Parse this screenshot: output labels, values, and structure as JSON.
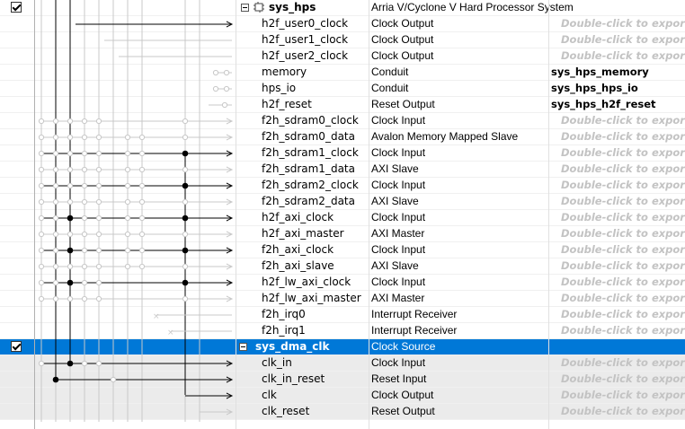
{
  "rows": [
    {
      "checkbox": true,
      "expander": true,
      "icon": "hps-chip-icon",
      "indent": 1,
      "name": "sys_hps",
      "bold": true,
      "description": "Arria V/Cyclone V Hard Processor System",
      "export": "",
      "export_type": "none",
      "style": "normal"
    },
    {
      "checkbox": false,
      "expander": false,
      "icon": "",
      "indent": 2,
      "name": "h2f_user0_clock",
      "bold": false,
      "description": "Clock Output",
      "export": "Double-click to export",
      "export_type": "placeholder",
      "style": "normal"
    },
    {
      "checkbox": false,
      "expander": false,
      "icon": "",
      "indent": 2,
      "name": "h2f_user1_clock",
      "bold": false,
      "description": "Clock Output",
      "export": "Double-click to export",
      "export_type": "placeholder",
      "style": "normal"
    },
    {
      "checkbox": false,
      "expander": false,
      "icon": "",
      "indent": 2,
      "name": "h2f_user2_clock",
      "bold": false,
      "description": "Clock Output",
      "export": "Double-click to export",
      "export_type": "placeholder",
      "style": "normal"
    },
    {
      "checkbox": false,
      "expander": false,
      "icon": "",
      "indent": 2,
      "name": "memory",
      "bold": false,
      "description": "Conduit",
      "export": "sys_hps_memory",
      "export_type": "named",
      "style": "normal"
    },
    {
      "checkbox": false,
      "expander": false,
      "icon": "",
      "indent": 2,
      "name": "hps_io",
      "bold": false,
      "description": "Conduit",
      "export": "sys_hps_hps_io",
      "export_type": "named",
      "style": "normal"
    },
    {
      "checkbox": false,
      "expander": false,
      "icon": "",
      "indent": 2,
      "name": "h2f_reset",
      "bold": false,
      "description": "Reset Output",
      "export": "sys_hps_h2f_reset",
      "export_type": "named",
      "style": "normal"
    },
    {
      "checkbox": false,
      "expander": false,
      "icon": "",
      "indent": 2,
      "name": "f2h_sdram0_clock",
      "bold": false,
      "description": "Clock Input",
      "export": "Double-click to export",
      "export_type": "placeholder",
      "style": "normal"
    },
    {
      "checkbox": false,
      "expander": false,
      "icon": "",
      "indent": 2,
      "name": "f2h_sdram0_data",
      "bold": false,
      "description": "Avalon Memory Mapped Slave",
      "export": "Double-click to export",
      "export_type": "placeholder",
      "style": "normal"
    },
    {
      "checkbox": false,
      "expander": false,
      "icon": "",
      "indent": 2,
      "name": "f2h_sdram1_clock",
      "bold": false,
      "description": "Clock Input",
      "export": "Double-click to export",
      "export_type": "placeholder",
      "style": "normal"
    },
    {
      "checkbox": false,
      "expander": false,
      "icon": "",
      "indent": 2,
      "name": "f2h_sdram1_data",
      "bold": false,
      "description": "AXI Slave",
      "export": "Double-click to export",
      "export_type": "placeholder",
      "style": "normal"
    },
    {
      "checkbox": false,
      "expander": false,
      "icon": "",
      "indent": 2,
      "name": "f2h_sdram2_clock",
      "bold": false,
      "description": "Clock Input",
      "export": "Double-click to export",
      "export_type": "placeholder",
      "style": "normal"
    },
    {
      "checkbox": false,
      "expander": false,
      "icon": "",
      "indent": 2,
      "name": "f2h_sdram2_data",
      "bold": false,
      "description": "AXI Slave",
      "export": "Double-click to export",
      "export_type": "placeholder",
      "style": "normal"
    },
    {
      "checkbox": false,
      "expander": false,
      "icon": "",
      "indent": 2,
      "name": "h2f_axi_clock",
      "bold": false,
      "description": "Clock Input",
      "export": "Double-click to export",
      "export_type": "placeholder",
      "style": "normal"
    },
    {
      "checkbox": false,
      "expander": false,
      "icon": "",
      "indent": 2,
      "name": "h2f_axi_master",
      "bold": false,
      "description": "AXI Master",
      "export": "Double-click to export",
      "export_type": "placeholder",
      "style": "normal"
    },
    {
      "checkbox": false,
      "expander": false,
      "icon": "",
      "indent": 2,
      "name": "f2h_axi_clock",
      "bold": false,
      "description": "Clock Input",
      "export": "Double-click to export",
      "export_type": "placeholder",
      "style": "normal"
    },
    {
      "checkbox": false,
      "expander": false,
      "icon": "",
      "indent": 2,
      "name": "f2h_axi_slave",
      "bold": false,
      "description": "AXI Slave",
      "export": "Double-click to export",
      "export_type": "placeholder",
      "style": "normal"
    },
    {
      "checkbox": false,
      "expander": false,
      "icon": "",
      "indent": 2,
      "name": "h2f_lw_axi_clock",
      "bold": false,
      "description": "Clock Input",
      "export": "Double-click to export",
      "export_type": "placeholder",
      "style": "normal"
    },
    {
      "checkbox": false,
      "expander": false,
      "icon": "",
      "indent": 2,
      "name": "h2f_lw_axi_master",
      "bold": false,
      "description": "AXI Master",
      "export": "Double-click to export",
      "export_type": "placeholder",
      "style": "normal"
    },
    {
      "checkbox": false,
      "expander": false,
      "icon": "",
      "indent": 2,
      "name": "f2h_irq0",
      "bold": false,
      "description": "Interrupt Receiver",
      "export": "Double-click to export",
      "export_type": "placeholder",
      "style": "normal"
    },
    {
      "checkbox": false,
      "expander": false,
      "icon": "",
      "indent": 2,
      "name": "f2h_irq1",
      "bold": false,
      "description": "Interrupt Receiver",
      "export": "Double-click to export",
      "export_type": "placeholder",
      "style": "normal"
    },
    {
      "checkbox": true,
      "expander": true,
      "icon": "",
      "indent": 1,
      "name": "sys_dma_clk",
      "bold": true,
      "description": "Clock Source",
      "export": "",
      "export_type": "none",
      "style": "selected"
    },
    {
      "checkbox": false,
      "expander": false,
      "icon": "",
      "indent": 2,
      "name": "clk_in",
      "bold": false,
      "description": "Clock Input",
      "export": "Double-click to export",
      "export_type": "placeholder",
      "style": "gray"
    },
    {
      "checkbox": false,
      "expander": false,
      "icon": "",
      "indent": 2,
      "name": "clk_in_reset",
      "bold": false,
      "description": "Reset Input",
      "export": "Double-click to export",
      "export_type": "placeholder",
      "style": "gray"
    },
    {
      "checkbox": false,
      "expander": false,
      "icon": "",
      "indent": 2,
      "name": "clk",
      "bold": false,
      "description": "Clock Output",
      "export": "Double-click to export",
      "export_type": "placeholder",
      "style": "gray"
    },
    {
      "checkbox": false,
      "expander": false,
      "icon": "",
      "indent": 2,
      "name": "clk_reset",
      "bold": false,
      "description": "Reset Output",
      "export": "Double-click to export",
      "export_type": "placeholder",
      "style": "gray"
    }
  ],
  "colors": {
    "selected_row": "#0078d7",
    "gray_row": "#ebebeb",
    "placeholder_text": "#c3c3c3",
    "active_wire": "#000000",
    "inactive_wire": "#c8c8c8"
  }
}
